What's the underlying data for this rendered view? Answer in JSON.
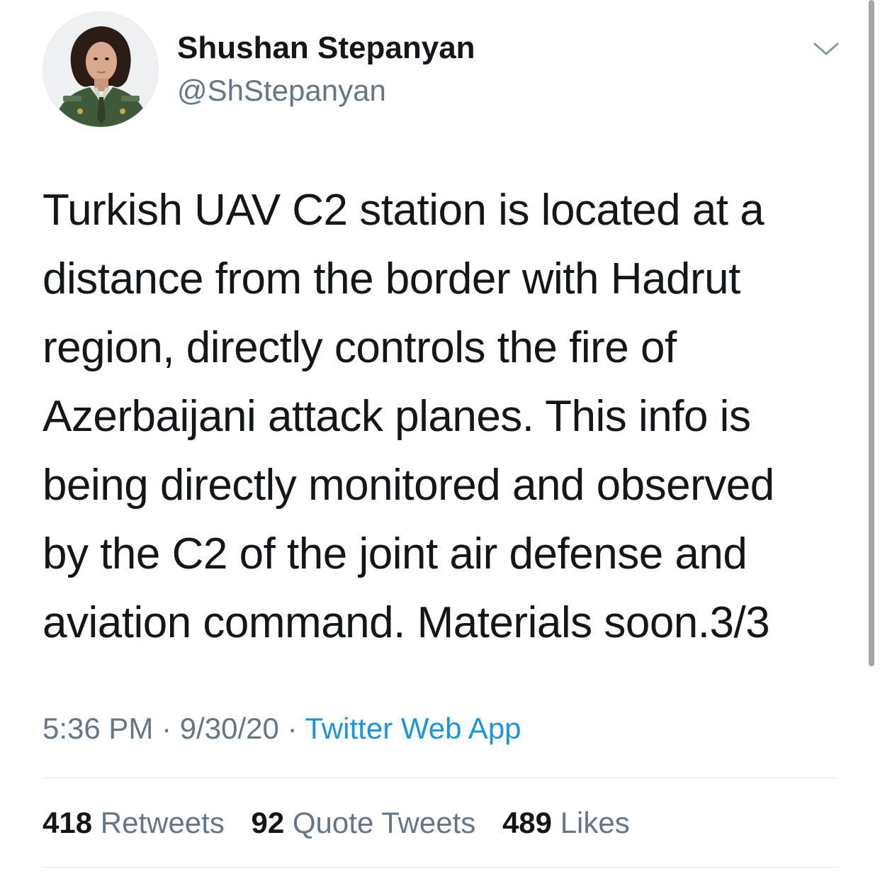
{
  "user": {
    "display_name": "Shushan Stepanyan",
    "handle": "@ShStepanyan"
  },
  "tweet": {
    "lines": [
      "Turkish UAV C2 station is located at a",
      "distance from the border with Hadrut",
      "region, directly controls the fire of",
      "Azerbaijani attack planes. This info is",
      "being directly monitored and observed",
      "by the C2 of the joint air defense and",
      "aviation command. Materials soon.3/3"
    ]
  },
  "meta": {
    "time": "5:36 PM",
    "separator": "·",
    "date": "9/30/20",
    "source": "Twitter Web App"
  },
  "stats": {
    "retweets_count": "418",
    "retweets_label": "Retweets",
    "quotes_count": "92",
    "quotes_label": "Quote Tweets",
    "likes_count": "489",
    "likes_label": "Likes"
  },
  "colors": {
    "text": "#14171a",
    "secondary": "#657786",
    "link": "#1b95e0",
    "divider": "#e1e8ed"
  },
  "icons": {
    "more": "chevron-down-icon",
    "avatar": "profile-photo"
  }
}
